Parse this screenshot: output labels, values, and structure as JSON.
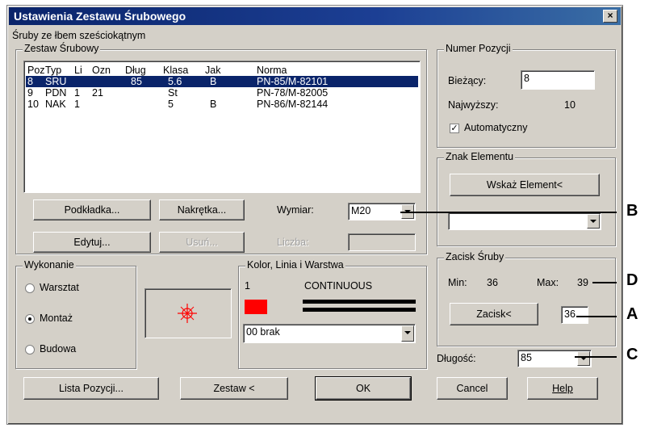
{
  "window": {
    "title": "Ustawienia Zestawu Śrubowego",
    "close_label": "×"
  },
  "subtitle": "Śruby ze łbem sześciokątnym",
  "zestaw": {
    "group_title": "Zestaw Śrubowy",
    "headers": [
      "Poz",
      "Typ",
      "Li",
      "Ozn",
      "Dług",
      "Klasa",
      "Jak",
      "Norma"
    ],
    "rows": [
      {
        "poz": "8",
        "typ": "SRU",
        "li": "",
        "ozn": "",
        "dlug": "85",
        "klasa": "5.6",
        "jak": "B",
        "norma": "PN-85/M-82101",
        "selected": true
      },
      {
        "poz": "9",
        "typ": "PDN",
        "li": "1",
        "ozn": "21",
        "dlug": "",
        "klasa": "St",
        "jak": "",
        "norma": "PN-78/M-82005",
        "selected": false
      },
      {
        "poz": "10",
        "typ": "NAK",
        "li": "1",
        "ozn": "",
        "dlug": "",
        "klasa": "5",
        "jak": "B",
        "norma": "PN-86/M-82144",
        "selected": false
      }
    ],
    "podkladka": "Podkładka...",
    "nakretka": "Nakrętka...",
    "edytuj": "Edytuj...",
    "usun": "Usuń...",
    "wymiar_label": "Wymiar:",
    "wymiar_value": "M20",
    "liczba_label": "Liczba:",
    "liczba_value": ""
  },
  "wykonanie": {
    "group_title": "Wykonanie",
    "options": [
      "Warsztat",
      "Montaż",
      "Budowa"
    ],
    "selected": "Montaż"
  },
  "kolor": {
    "group_title": "Kolor, Linia i Warstwa",
    "color_index": "1",
    "color_hex": "#ff0000",
    "linetype": "CONTINUOUS",
    "layer_value": "00  brak"
  },
  "numer": {
    "group_title": "Numer Pozycji",
    "biezacy_label": "Bieżący:",
    "biezacy_value": "8",
    "najwyzszy_label": "Najwyższy:",
    "najwyzszy_value": "10",
    "auto_label": "Automatyczny",
    "auto_checked": true
  },
  "znak": {
    "group_title": "Znak Elementu",
    "wskaz_label": "Wskaż Element<",
    "select_value": ""
  },
  "zacisk": {
    "group_title": "Zacisk Śruby",
    "min_label": "Min:",
    "min_value": "36",
    "max_label": "Max:",
    "max_value": "39",
    "button_label": "Zacisk<",
    "value": "36"
  },
  "dlugosc": {
    "label": "Długość:",
    "value": "85"
  },
  "bottom": {
    "lista": "Lista Pozycji...",
    "zestaw": "Zestaw <",
    "ok": "OK",
    "cancel": "Cancel",
    "help": "Help"
  },
  "callouts": {
    "a": "A",
    "b": "B",
    "c": "C",
    "d": "D"
  },
  "colors": {
    "title_bar": "#0a246a",
    "dialog": "#d4d0c8",
    "selection": "#0a246a",
    "accent_red": "#ff0000"
  }
}
